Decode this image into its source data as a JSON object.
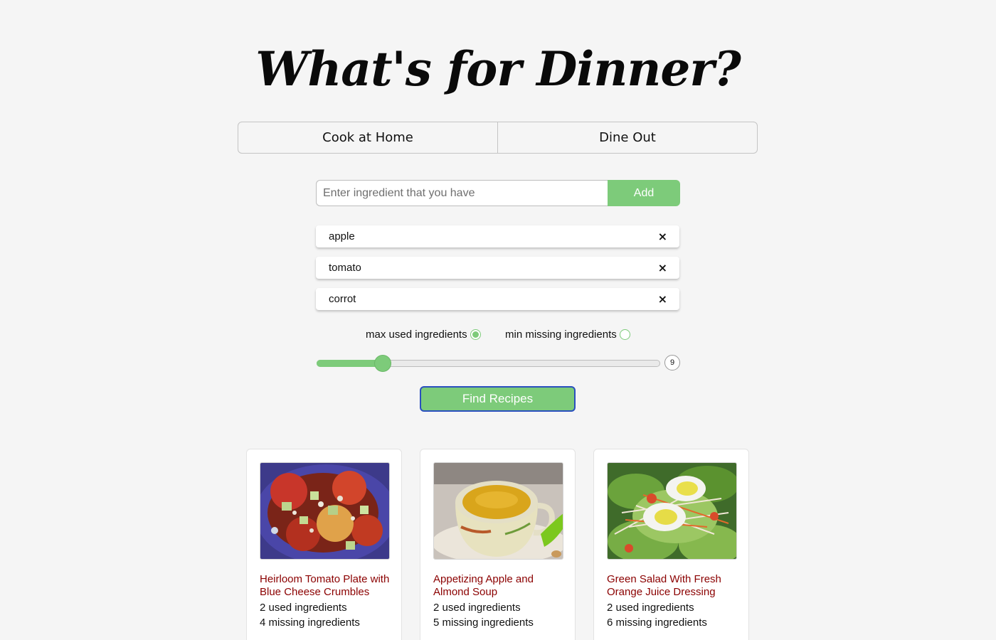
{
  "header": {
    "title": "What's for Dinner?"
  },
  "mode_tabs": [
    {
      "label": "Cook at Home"
    },
    {
      "label": "Dine Out"
    }
  ],
  "ingredient_form": {
    "placeholder": "Enter ingredient that you have",
    "value": "",
    "add_label": "Add"
  },
  "ingredients": [
    {
      "name": "apple",
      "remove_icon": "×"
    },
    {
      "name": "tomato",
      "remove_icon": "×"
    },
    {
      "name": "corrot",
      "remove_icon": "×"
    }
  ],
  "sort_options": [
    {
      "label": "max used ingredients",
      "checked": true
    },
    {
      "label": "min missing ingredients",
      "checked": false
    }
  ],
  "slider": {
    "value": 9,
    "min": 1,
    "max": 100
  },
  "find_button": {
    "label": "Find Recipes"
  },
  "recipes": [
    {
      "title": "Heirloom Tomato Plate with Blue Cheese Crumbles",
      "used": "2 used ingredients",
      "missing": "4 missing ingredients"
    },
    {
      "title": "Appetizing Apple and Almond Soup",
      "used": "2 used ingredients",
      "missing": "5 missing ingredients"
    },
    {
      "title": "Green Salad With Fresh Orange Juice Dressing",
      "used": "2 used ingredients",
      "missing": "6 missing ingredients"
    }
  ],
  "colors": {
    "accent": "#7dcb7a",
    "recipe_title": "#8b0000",
    "focus_border": "#2a4fbf"
  }
}
